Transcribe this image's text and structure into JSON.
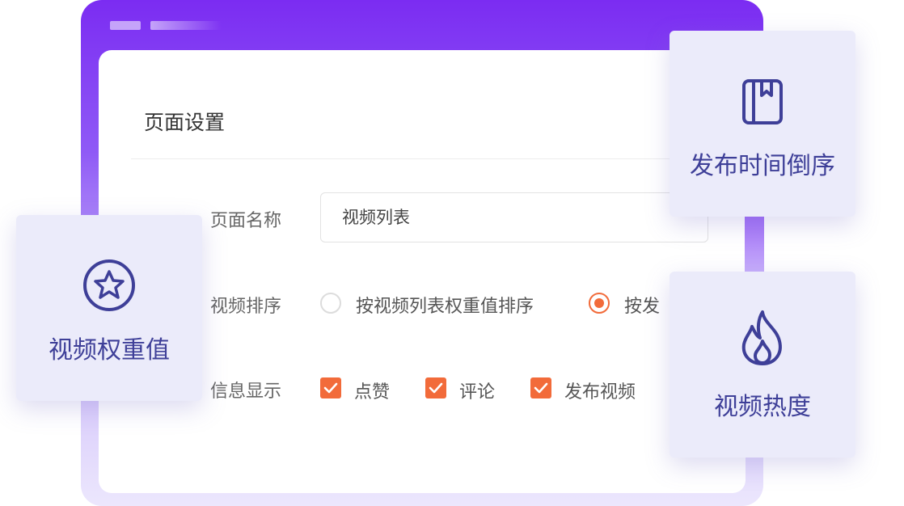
{
  "panel": {
    "title": "页面设置",
    "name_label": "页面名称",
    "name_value": "视频列表",
    "sort_label": "视频排序",
    "sort_options": [
      {
        "label": "按视频列表权重值排序",
        "selected": false
      },
      {
        "label": "按发",
        "selected": true
      }
    ],
    "info_label": "信息显示",
    "info_options": [
      {
        "label": "点赞",
        "checked": true
      },
      {
        "label": "评论",
        "checked": true
      },
      {
        "label": "发布视频",
        "checked": true
      }
    ]
  },
  "cards": {
    "weight": {
      "label": "视频权重值",
      "icon": "star-icon"
    },
    "publish_time": {
      "label": "发布时间倒序",
      "icon": "bookmark-book-icon"
    },
    "heat": {
      "label": "视频热度",
      "icon": "flame-icon"
    }
  },
  "colors": {
    "accent": "#f26b3a",
    "card_text": "#3e3f98",
    "frame_top": "#7b2cf2"
  }
}
